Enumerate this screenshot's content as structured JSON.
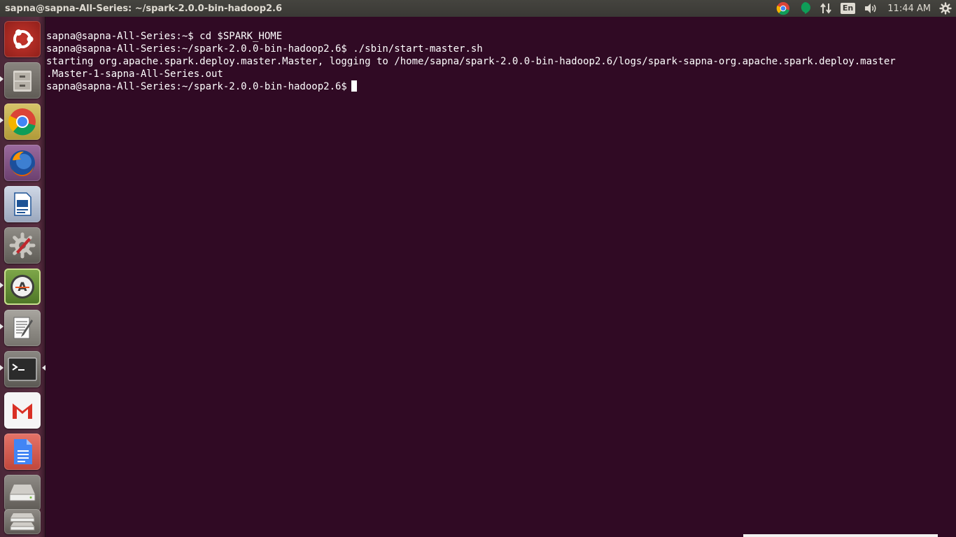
{
  "window": {
    "title": "sapna@sapna-All-Series: ~/spark-2.0.0-bin-hadoop2.6"
  },
  "indicators": {
    "language": "En",
    "clock": "11:44 AM"
  },
  "launcher": {
    "items": [
      "dash-home",
      "files",
      "chrome",
      "firefox",
      "libreoffice-writer",
      "system-settings",
      "software-updater",
      "text-editor",
      "terminal",
      "gmail",
      "google-docs",
      "disk-drive",
      "trash"
    ]
  },
  "terminal": {
    "lines": [
      "sapna@sapna-All-Series:~$ cd $SPARK_HOME",
      "sapna@sapna-All-Series:~/spark-2.0.0-bin-hadoop2.6$ ./sbin/start-master.sh",
      "starting org.apache.spark.deploy.master.Master, logging to /home/sapna/spark-2.0.0-bin-hadoop2.6/logs/spark-sapna-org.apache.spark.deploy.master",
      ".Master-1-sapna-All-Series.out",
      "sapna@sapna-All-Series:~/spark-2.0.0-bin-hadoop2.6$"
    ]
  },
  "colors": {
    "terminal_bg": "#300a24",
    "panel_bg": "#3c3b37",
    "launcher_bg": "#552b3e",
    "text": "#ffffff"
  }
}
